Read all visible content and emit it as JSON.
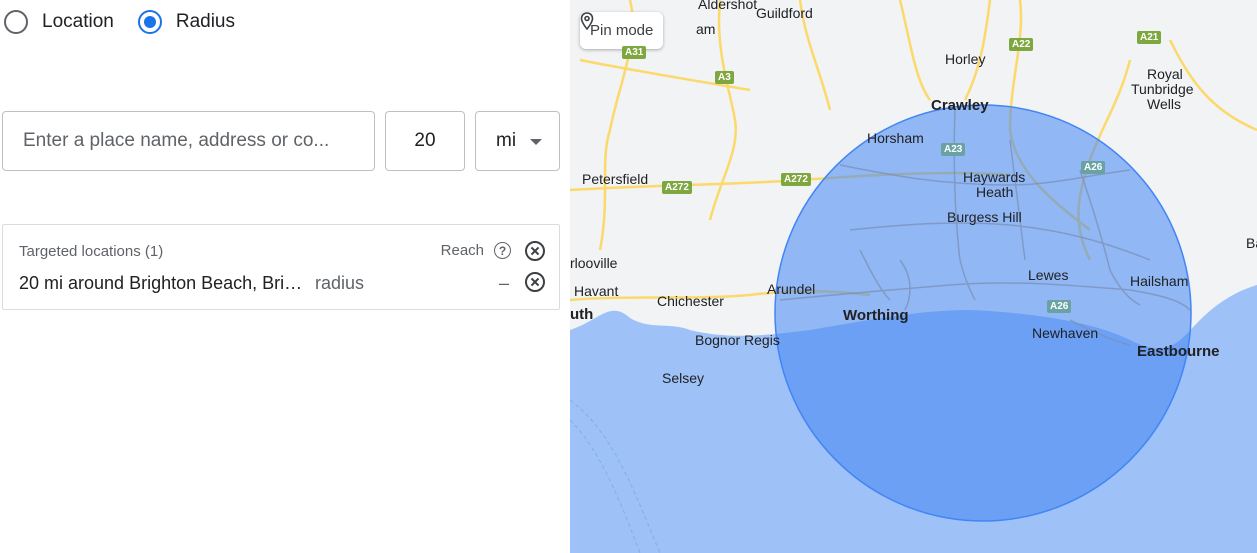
{
  "mode": {
    "location_label": "Location",
    "radius_label": "Radius",
    "selected": "radius"
  },
  "search": {
    "placeholder": "Enter a place name, address or co...",
    "radius_value": "20",
    "unit": "mi"
  },
  "targeted": {
    "header": "Targeted locations (1)",
    "reach_label": "Reach",
    "items": [
      {
        "name": "20 mi around Brighton Beach, Brig...",
        "type": "radius",
        "reach": "–"
      }
    ]
  },
  "map": {
    "pin_mode_label": "Pin mode",
    "places": [
      {
        "name": "Aldershot"
      },
      {
        "name": "Guildford"
      },
      {
        "name": "Horley"
      },
      {
        "name": "Crawley"
      },
      {
        "name": "Royal"
      },
      {
        "name": "Tunbridge"
      },
      {
        "name": "Wells"
      },
      {
        "name": "Horsham"
      },
      {
        "name": "Haywards"
      },
      {
        "name": "Heath"
      },
      {
        "name": "Burgess Hill"
      },
      {
        "name": "Petersfield"
      },
      {
        "name": "rlooville"
      },
      {
        "name": "Havant"
      },
      {
        "name": "Chichester"
      },
      {
        "name": "Arundel"
      },
      {
        "name": "Lewes"
      },
      {
        "name": "Hailsham"
      },
      {
        "name": "uth"
      },
      {
        "name": "Worthing"
      },
      {
        "name": "Newhaven"
      },
      {
        "name": "Eastbourne"
      },
      {
        "name": "Bognor Regis"
      },
      {
        "name": "Selsey"
      },
      {
        "name": "am"
      },
      {
        "name": "Ba"
      }
    ],
    "roads": [
      "A31",
      "A3",
      "A22",
      "A21",
      "A23",
      "A26",
      "A272",
      "A272",
      "A26",
      "A26"
    ],
    "colors": {
      "land": "#f1f3f4",
      "sea": "#9ec2f7",
      "circle_fill": "#4285f4",
      "circle_stroke": "#4285f4",
      "road": "#fbd96a"
    }
  }
}
